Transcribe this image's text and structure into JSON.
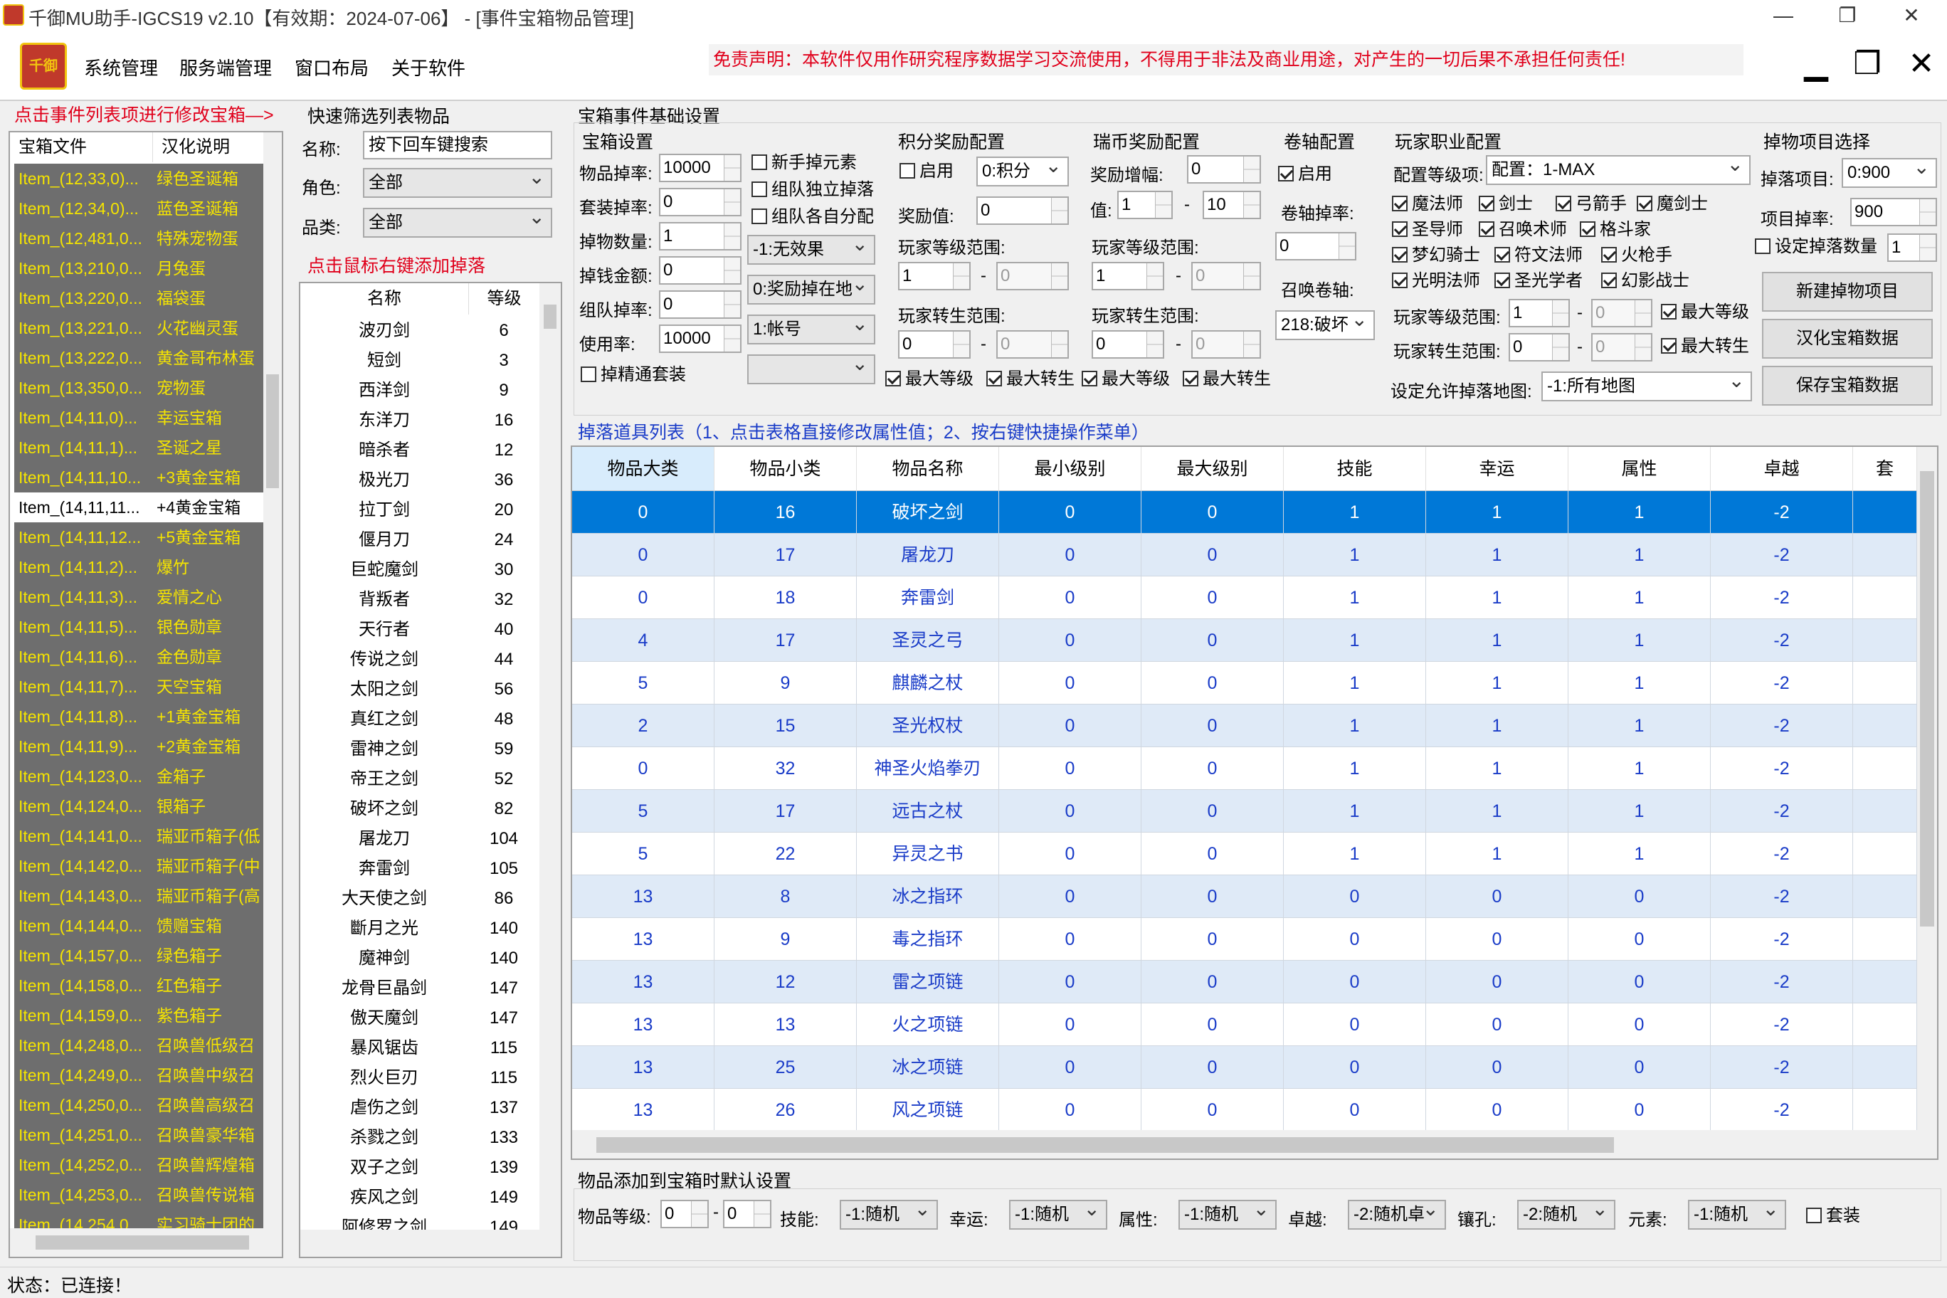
{
  "window": {
    "title": "千御MU助手-IGCS19 v2.10【有效期：2024-07-06】 - [事件宝箱物品管理]",
    "min": "—",
    "restore": "❐",
    "close": "✕"
  },
  "menu": {
    "logo": "千御\nMUGM",
    "items": [
      "系统管理",
      "服务端管理",
      "窗口布局",
      "关于软件"
    ],
    "disclaimer": "免责声明：本软件仅用作研究程序数据学习交流使用，不得用于非法及商业用途，对产生的一切后果不承担任何责任!",
    "mdi_min": "▁",
    "mdi_restore": "❐",
    "mdi_close": "✕"
  },
  "left": {
    "hint": "点击事件列表项进行修改宝箱—>",
    "col1": "宝箱文件",
    "col2": "汉化说明",
    "items": [
      [
        "Item_(12,33,0)...",
        "绿色圣诞箱"
      ],
      [
        "Item_(12,34,0)...",
        "蓝色圣诞箱"
      ],
      [
        "Item_(12,481,0...",
        "特殊宠物蛋"
      ],
      [
        "Item_(13,210,0...",
        "月兔蛋"
      ],
      [
        "Item_(13,220,0...",
        "福袋蛋"
      ],
      [
        "Item_(13,221,0...",
        "火花幽灵蛋"
      ],
      [
        "Item_(13,222,0...",
        "黄金哥布林蛋"
      ],
      [
        "Item_(13,350,0...",
        "宠物蛋"
      ],
      [
        "Item_(14,11,0)...",
        "幸运宝箱"
      ],
      [
        "Item_(14,11,1)...",
        "圣诞之星"
      ],
      [
        "Item_(14,11,10...",
        "+3黄金宝箱"
      ],
      [
        "Item_(14,11,11...",
        "+4黄金宝箱"
      ],
      [
        "Item_(14,11,12...",
        "+5黄金宝箱"
      ],
      [
        "Item_(14,11,2)...",
        "爆竹"
      ],
      [
        "Item_(14,11,3)...",
        "爱情之心"
      ],
      [
        "Item_(14,11,5)...",
        "银色勋章"
      ],
      [
        "Item_(14,11,6)...",
        "金色勋章"
      ],
      [
        "Item_(14,11,7)...",
        "天空宝箱"
      ],
      [
        "Item_(14,11,8)...",
        "+1黄金宝箱"
      ],
      [
        "Item_(14,11,9)...",
        "+2黄金宝箱"
      ],
      [
        "Item_(14,123,0...",
        "金箱子"
      ],
      [
        "Item_(14,124,0...",
        "银箱子"
      ],
      [
        "Item_(14,141,0...",
        "瑞亚币箱子(低"
      ],
      [
        "Item_(14,142,0...",
        "瑞亚币箱子(中"
      ],
      [
        "Item_(14,143,0...",
        "瑞亚币箱子(高"
      ],
      [
        "Item_(14,144,0...",
        "馈赠宝箱"
      ],
      [
        "Item_(14,157,0...",
        "绿色箱子"
      ],
      [
        "Item_(14,158,0...",
        "红色箱子"
      ],
      [
        "Item_(14,159,0...",
        "紫色箱子"
      ],
      [
        "Item_(14,248,0...",
        "召唤兽低级召"
      ],
      [
        "Item_(14,249,0...",
        "召唤兽中级召"
      ],
      [
        "Item_(14,250,0...",
        "召唤兽高级召"
      ],
      [
        "Item_(14,251,0...",
        "召唤兽豪华箱"
      ],
      [
        "Item_(14,252,0...",
        "召唤兽辉煌箱"
      ],
      [
        "Item_(14,253,0...",
        "召唤兽传说箱"
      ],
      [
        "Item_(14,254,0...",
        "实习骑士团的"
      ]
    ],
    "selected_index": 11
  },
  "filter": {
    "title": "快速筛选列表物品",
    "name_label": "名称:",
    "name_value": "按下回车键搜索",
    "role_label": "角色:",
    "role_value": "全部",
    "class_label": "品类:",
    "class_value": "全部",
    "hint": "点击鼠标右键添加掉落",
    "col_name": "名称",
    "col_level": "等级",
    "items": [
      [
        "波刃剑",
        "6"
      ],
      [
        "短剑",
        "3"
      ],
      [
        "西洋剑",
        "9"
      ],
      [
        "东洋刀",
        "16"
      ],
      [
        "暗杀者",
        "12"
      ],
      [
        "极光刀",
        "36"
      ],
      [
        "拉丁剑",
        "20"
      ],
      [
        "偃月刀",
        "24"
      ],
      [
        "巨蛇魔剑",
        "30"
      ],
      [
        "背叛者",
        "32"
      ],
      [
        "天行者",
        "40"
      ],
      [
        "传说之剑",
        "44"
      ],
      [
        "太阳之剑",
        "56"
      ],
      [
        "真红之剑",
        "48"
      ],
      [
        "雷神之剑",
        "59"
      ],
      [
        "帝王之剑",
        "52"
      ],
      [
        "破坏之剑",
        "82"
      ],
      [
        "屠龙刀",
        "104"
      ],
      [
        "奔雷剑",
        "105"
      ],
      [
        "大天使之剑",
        "86"
      ],
      [
        "斷月之光",
        "140"
      ],
      [
        "魔神剑",
        "140"
      ],
      [
        "龙骨巨晶剑",
        "147"
      ],
      [
        "傲天魔剑",
        "147"
      ],
      [
        "暴风锯齿",
        "115"
      ],
      [
        "烈火巨刃",
        "115"
      ],
      [
        "虐伤之剑",
        "137"
      ],
      [
        "杀戮之剑",
        "133"
      ],
      [
        "双子之剑",
        "139"
      ],
      [
        "疾风之剑",
        "149"
      ],
      [
        "阿修罗之剑",
        "149"
      ]
    ]
  },
  "basic": {
    "title": "宝箱事件基础设置",
    "box": {
      "title": "宝箱设置",
      "rate_label": "物品掉率:",
      "rate": "10000",
      "set_rate_label": "套装掉率:",
      "set_rate": "0",
      "count_label": "掉物数量:",
      "count": "1",
      "money_label": "掉钱金额:",
      "money": "0",
      "group_label": "组队掉率:",
      "group": "0",
      "use_label": "使用率:",
      "use": "10000",
      "chk_new": "新手掉元素",
      "chk_solo": "组队独立掉落",
      "chk_share": "组队各自分配",
      "combo_effect": "-1:无效果",
      "combo_reward": "0:奖励掉在地",
      "combo_account": "1:帐号",
      "combo_empty": "",
      "chk_fine": "掉精通套装"
    },
    "points": {
      "title": "积分奖励配置",
      "enable": "启用",
      "type": "0:积分",
      "value_label": "奖励值:",
      "value": "0",
      "level_label": "玩家等级范围:",
      "level_min": "1",
      "level_max": "0",
      "reset_label": "玩家转生范围:",
      "reset_min": "0",
      "reset_max": "0",
      "chk_maxlevel": "最大等级",
      "chk_maxreset": "最大转生"
    },
    "ruby": {
      "title": "瑞币奖励配置",
      "inc_label": "奖励增幅:",
      "inc": "0",
      "value_label": "值:",
      "v_min": "1",
      "v_max": "10",
      "level_label": "玩家等级范围:",
      "level_min": "1",
      "level_max": "0",
      "reset_label": "玩家转生范围:",
      "reset_min": "0",
      "reset_max": "0",
      "chk_maxlevel": "最大等级",
      "chk_maxreset": "最大转生"
    },
    "scroll": {
      "title": "卷轴配置",
      "enable": "启用",
      "rate_label": "卷轴掉率:",
      "rate": "0",
      "summon_label": "召唤卷轴:",
      "summon": "218:破坏"
    },
    "job": {
      "title": "玩家职业配置",
      "cfg_label": "配置等级项:",
      "cfg": "配置：1-MAX",
      "classes": [
        "魔法师",
        "剑士",
        "弓箭手",
        "魔剑士",
        "圣导师",
        "召唤术师",
        "格斗家",
        "梦幻骑士",
        "符文法师",
        "火枪手",
        "光明法师",
        "圣光学者",
        "幻影战士"
      ],
      "level_label": "玩家等级范围:",
      "level_min": "1",
      "level_max": "0",
      "chk_maxlevel": "最大等级",
      "reset_label": "玩家转生范围:",
      "reset_min": "0",
      "reset_max": "0",
      "chk_maxreset": "最大转生",
      "map_label": "设定允许掉落地图:",
      "map": "-1:所有地图"
    },
    "pick": {
      "title": "掉物项目选择",
      "item_label": "掉落项目:",
      "item": "0:900",
      "rate_label": "项目掉率:",
      "rate": "900",
      "chk_count": "设定掉落数量",
      "count": "1",
      "btn_new": "新建掉物项目",
      "btn_cn": "汉化宝箱数据",
      "btn_save": "保存宝箱数据"
    }
  },
  "table": {
    "title": "掉落道具列表（1、点击表格直接修改属性值；2、按右键快捷操作菜单）",
    "columns": [
      "物品大类",
      "物品小类",
      "物品名称",
      "最小级别",
      "最大级别",
      "技能",
      "幸运",
      "属性",
      "卓越",
      "套"
    ],
    "rows": [
      [
        "0",
        "16",
        "破坏之剑",
        "0",
        "0",
        "1",
        "1",
        "1",
        "-2"
      ],
      [
        "0",
        "17",
        "屠龙刀",
        "0",
        "0",
        "1",
        "1",
        "1",
        "-2"
      ],
      [
        "0",
        "18",
        "奔雷剑",
        "0",
        "0",
        "1",
        "1",
        "1",
        "-2"
      ],
      [
        "4",
        "17",
        "圣灵之弓",
        "0",
        "0",
        "1",
        "1",
        "1",
        "-2"
      ],
      [
        "5",
        "9",
        "麒麟之杖",
        "0",
        "0",
        "1",
        "1",
        "1",
        "-2"
      ],
      [
        "2",
        "15",
        "圣光权杖",
        "0",
        "0",
        "1",
        "1",
        "1",
        "-2"
      ],
      [
        "0",
        "32",
        "神圣火焰拳刃",
        "0",
        "0",
        "1",
        "1",
        "1",
        "-2"
      ],
      [
        "5",
        "17",
        "远古之杖",
        "0",
        "0",
        "1",
        "1",
        "1",
        "-2"
      ],
      [
        "5",
        "22",
        "异灵之书",
        "0",
        "0",
        "1",
        "1",
        "1",
        "-2"
      ],
      [
        "13",
        "8",
        "冰之指环",
        "0",
        "0",
        "0",
        "0",
        "0",
        "-2"
      ],
      [
        "13",
        "9",
        "毒之指环",
        "0",
        "0",
        "0",
        "0",
        "0",
        "-2"
      ],
      [
        "13",
        "12",
        "雷之项链",
        "0",
        "0",
        "0",
        "0",
        "0",
        "-2"
      ],
      [
        "13",
        "13",
        "火之项链",
        "0",
        "0",
        "0",
        "0",
        "0",
        "-2"
      ],
      [
        "13",
        "25",
        "冰之项链",
        "0",
        "0",
        "0",
        "0",
        "0",
        "-2"
      ],
      [
        "13",
        "26",
        "风之项链",
        "0",
        "0",
        "0",
        "0",
        "0",
        "-2"
      ]
    ]
  },
  "defaults": {
    "title": "物品添加到宝箱时默认设置",
    "level_label": "物品等级:",
    "level_min": "0",
    "level_max": "0",
    "skill_label": "技能:",
    "skill": "-1:随机",
    "luck_label": "幸运:",
    "luck": "-1:随机",
    "attr_label": "属性:",
    "attr": "-1:随机",
    "exc_label": "卓越:",
    "exc": "-2:随机卓",
    "socket_label": "镶孔:",
    "socket": "-2:随机",
    "elem_label": "元素:",
    "elem": "-1:随机",
    "chk_set": "套装"
  },
  "status": {
    "text": "状态：已连接！"
  }
}
